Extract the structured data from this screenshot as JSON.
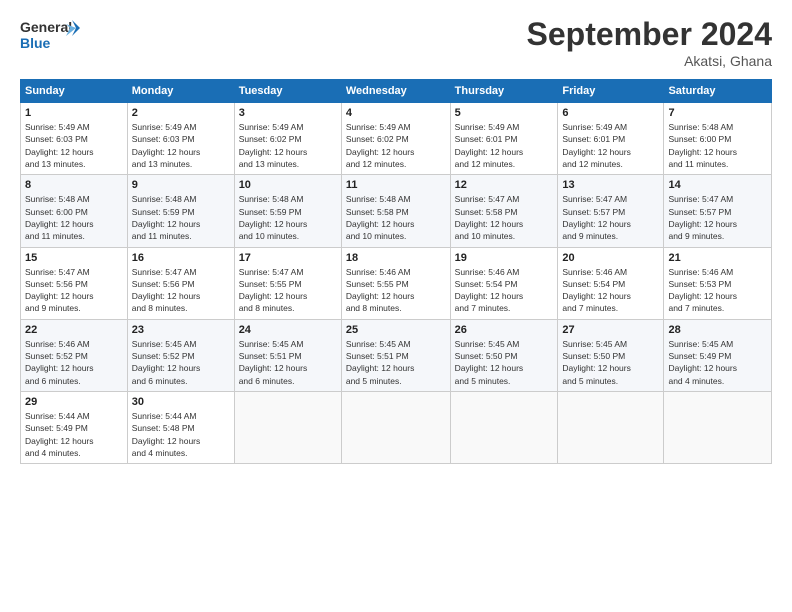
{
  "logo": {
    "line1": "General",
    "line2": "Blue"
  },
  "title": "September 2024",
  "subtitle": "Akatsi, Ghana",
  "days_of_week": [
    "Sunday",
    "Monday",
    "Tuesday",
    "Wednesday",
    "Thursday",
    "Friday",
    "Saturday"
  ],
  "weeks": [
    [
      {
        "day": "1",
        "info": "Sunrise: 5:49 AM\nSunset: 6:03 PM\nDaylight: 12 hours\nand 13 minutes."
      },
      {
        "day": "2",
        "info": "Sunrise: 5:49 AM\nSunset: 6:03 PM\nDaylight: 12 hours\nand 13 minutes."
      },
      {
        "day": "3",
        "info": "Sunrise: 5:49 AM\nSunset: 6:02 PM\nDaylight: 12 hours\nand 13 minutes."
      },
      {
        "day": "4",
        "info": "Sunrise: 5:49 AM\nSunset: 6:02 PM\nDaylight: 12 hours\nand 12 minutes."
      },
      {
        "day": "5",
        "info": "Sunrise: 5:49 AM\nSunset: 6:01 PM\nDaylight: 12 hours\nand 12 minutes."
      },
      {
        "day": "6",
        "info": "Sunrise: 5:49 AM\nSunset: 6:01 PM\nDaylight: 12 hours\nand 12 minutes."
      },
      {
        "day": "7",
        "info": "Sunrise: 5:48 AM\nSunset: 6:00 PM\nDaylight: 12 hours\nand 11 minutes."
      }
    ],
    [
      {
        "day": "8",
        "info": "Sunrise: 5:48 AM\nSunset: 6:00 PM\nDaylight: 12 hours\nand 11 minutes."
      },
      {
        "day": "9",
        "info": "Sunrise: 5:48 AM\nSunset: 5:59 PM\nDaylight: 12 hours\nand 11 minutes."
      },
      {
        "day": "10",
        "info": "Sunrise: 5:48 AM\nSunset: 5:59 PM\nDaylight: 12 hours\nand 10 minutes."
      },
      {
        "day": "11",
        "info": "Sunrise: 5:48 AM\nSunset: 5:58 PM\nDaylight: 12 hours\nand 10 minutes."
      },
      {
        "day": "12",
        "info": "Sunrise: 5:47 AM\nSunset: 5:58 PM\nDaylight: 12 hours\nand 10 minutes."
      },
      {
        "day": "13",
        "info": "Sunrise: 5:47 AM\nSunset: 5:57 PM\nDaylight: 12 hours\nand 9 minutes."
      },
      {
        "day": "14",
        "info": "Sunrise: 5:47 AM\nSunset: 5:57 PM\nDaylight: 12 hours\nand 9 minutes."
      }
    ],
    [
      {
        "day": "15",
        "info": "Sunrise: 5:47 AM\nSunset: 5:56 PM\nDaylight: 12 hours\nand 9 minutes."
      },
      {
        "day": "16",
        "info": "Sunrise: 5:47 AM\nSunset: 5:56 PM\nDaylight: 12 hours\nand 8 minutes."
      },
      {
        "day": "17",
        "info": "Sunrise: 5:47 AM\nSunset: 5:55 PM\nDaylight: 12 hours\nand 8 minutes."
      },
      {
        "day": "18",
        "info": "Sunrise: 5:46 AM\nSunset: 5:55 PM\nDaylight: 12 hours\nand 8 minutes."
      },
      {
        "day": "19",
        "info": "Sunrise: 5:46 AM\nSunset: 5:54 PM\nDaylight: 12 hours\nand 7 minutes."
      },
      {
        "day": "20",
        "info": "Sunrise: 5:46 AM\nSunset: 5:54 PM\nDaylight: 12 hours\nand 7 minutes."
      },
      {
        "day": "21",
        "info": "Sunrise: 5:46 AM\nSunset: 5:53 PM\nDaylight: 12 hours\nand 7 minutes."
      }
    ],
    [
      {
        "day": "22",
        "info": "Sunrise: 5:46 AM\nSunset: 5:52 PM\nDaylight: 12 hours\nand 6 minutes."
      },
      {
        "day": "23",
        "info": "Sunrise: 5:45 AM\nSunset: 5:52 PM\nDaylight: 12 hours\nand 6 minutes."
      },
      {
        "day": "24",
        "info": "Sunrise: 5:45 AM\nSunset: 5:51 PM\nDaylight: 12 hours\nand 6 minutes."
      },
      {
        "day": "25",
        "info": "Sunrise: 5:45 AM\nSunset: 5:51 PM\nDaylight: 12 hours\nand 5 minutes."
      },
      {
        "day": "26",
        "info": "Sunrise: 5:45 AM\nSunset: 5:50 PM\nDaylight: 12 hours\nand 5 minutes."
      },
      {
        "day": "27",
        "info": "Sunrise: 5:45 AM\nSunset: 5:50 PM\nDaylight: 12 hours\nand 5 minutes."
      },
      {
        "day": "28",
        "info": "Sunrise: 5:45 AM\nSunset: 5:49 PM\nDaylight: 12 hours\nand 4 minutes."
      }
    ],
    [
      {
        "day": "29",
        "info": "Sunrise: 5:44 AM\nSunset: 5:49 PM\nDaylight: 12 hours\nand 4 minutes."
      },
      {
        "day": "30",
        "info": "Sunrise: 5:44 AM\nSunset: 5:48 PM\nDaylight: 12 hours\nand 4 minutes."
      },
      {
        "day": "",
        "info": ""
      },
      {
        "day": "",
        "info": ""
      },
      {
        "day": "",
        "info": ""
      },
      {
        "day": "",
        "info": ""
      },
      {
        "day": "",
        "info": ""
      }
    ]
  ]
}
